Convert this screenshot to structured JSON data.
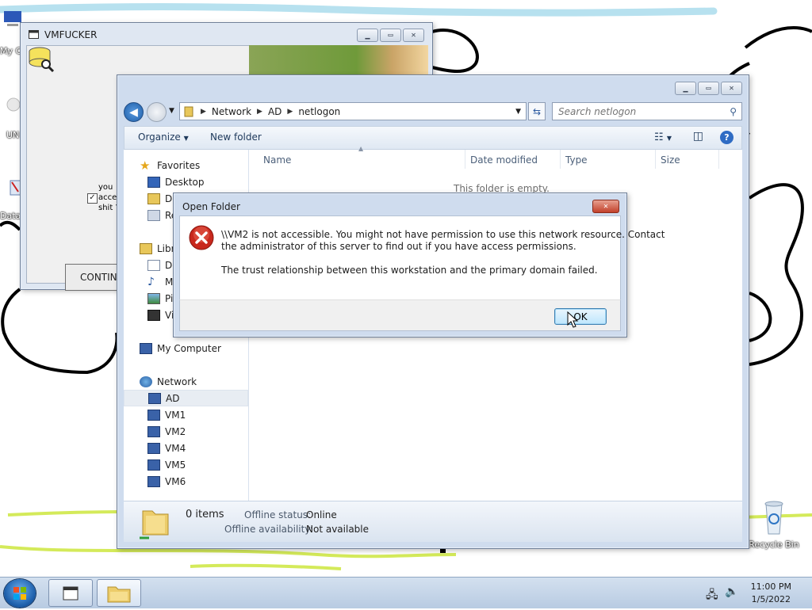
{
  "desktop": {
    "icons": [
      {
        "label": "My C"
      },
      {
        "label": "UN"
      },
      {
        "label": "Data"
      }
    ],
    "recycle_bin": "Recycle Bin"
  },
  "vmfucker_window": {
    "title": "VMFUCKER",
    "checkbox_text": [
      "you",
      "acce",
      "shit ?"
    ],
    "checked": true,
    "continue_label": "CONTINU"
  },
  "explorer": {
    "breadcrumb": [
      "Network",
      "AD",
      "netlogon"
    ],
    "search_placeholder": "Search netlogon",
    "toolbar": {
      "organize": "Organize",
      "new_folder": "New folder"
    },
    "nav": {
      "favorites": "Favorites",
      "desktop": "Desktop",
      "downloads": "Do",
      "recent": "Re",
      "libraries": "Libra",
      "documents": "Do",
      "music": "M",
      "pictures": "Pi",
      "videos": "Vi",
      "my_computer": "My Computer",
      "network": "Network",
      "hosts": [
        "AD",
        "VM1",
        "VM2",
        "VM4",
        "VM5",
        "VM6"
      ]
    },
    "columns": [
      "Name",
      "Date modified",
      "Type",
      "Size"
    ],
    "empty_text": "This folder is empty.",
    "details": {
      "items": "0 items",
      "offline_status_label": "Offline status:",
      "offline_status_value": "Online",
      "offline_availability_label": "Offline availability:",
      "offline_availability_value": "Not available"
    }
  },
  "dialog": {
    "title": "Open Folder",
    "message_line1": "\\\\VM2 is not accessible. You might not have permission to use this network resource. Contact",
    "message_line2": "the administrator of this server to find out if you have access permissions.",
    "detail": "The trust relationship between this workstation and the primary domain failed.",
    "ok_label": "OK"
  },
  "taskbar": {
    "time": "11:00 PM",
    "date": "1/5/2022"
  }
}
